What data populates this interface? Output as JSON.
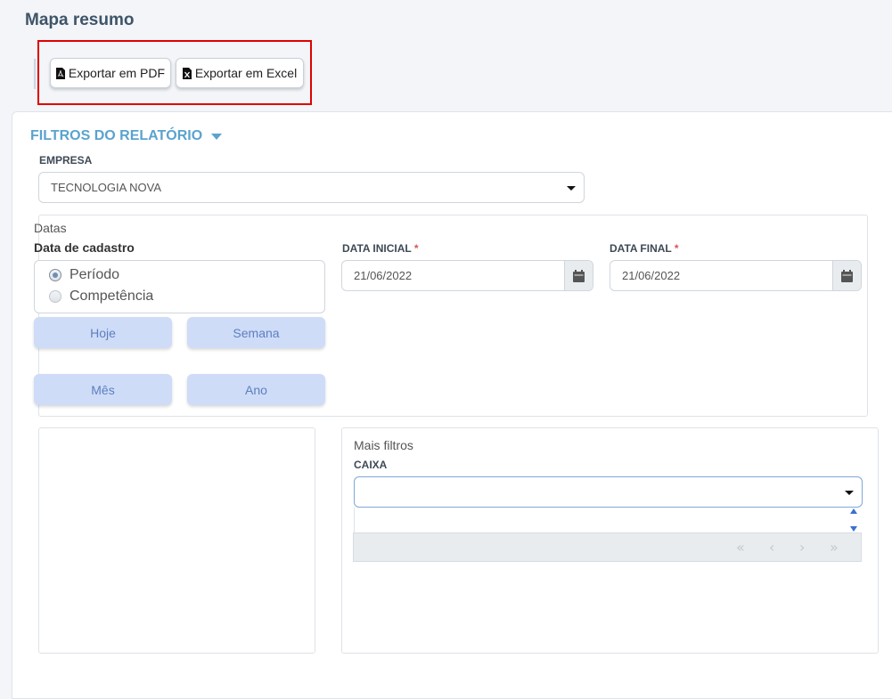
{
  "page": {
    "title": "Mapa resumo"
  },
  "export": {
    "pdf_label": "Exportar em PDF",
    "excel_label": "Exportar em Excel"
  },
  "filters": {
    "title": "FILTROS DO RELATÓRIO",
    "empresa": {
      "label": "EMPRESA",
      "value": "TECNOLOGIA NOVA"
    },
    "datas": {
      "legend": "Datas",
      "cadastro_label": "Data de cadastro",
      "options": [
        {
          "label": "Período",
          "checked": true
        },
        {
          "label": "Competência",
          "checked": false
        }
      ],
      "quick": {
        "hoje": "Hoje",
        "semana": "Semana",
        "mes": "Mês",
        "ano": "Ano"
      },
      "inicial": {
        "label": "DATA INICIAL",
        "required_mark": "*",
        "value": "21/06/2022"
      },
      "final": {
        "label": "DATA FINAL",
        "required_mark": "*",
        "value": "21/06/2022"
      }
    },
    "mais": {
      "legend": "Mais filtros",
      "caixa": {
        "label": "CAIXA",
        "value": ""
      },
      "pager": {
        "first": "«",
        "prev": "‹",
        "next": "›",
        "last": "»"
      }
    }
  },
  "colors": {
    "accent": "#5aa3cf",
    "highlight": "#e00000",
    "quick_button_bg": "#cfdcf7",
    "quick_button_text": "#5c7fc0"
  },
  "icons": {
    "pdf": "file-pdf-icon",
    "excel": "file-excel-icon",
    "calendar": "calendar-icon"
  }
}
